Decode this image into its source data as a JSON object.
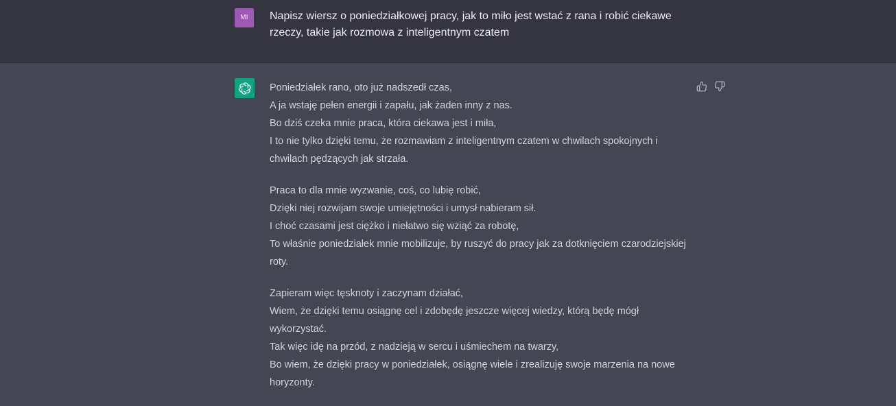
{
  "user_message": {
    "avatar_initials": "MI",
    "avatar_color": "#9d59b4",
    "text": "Napisz wiersz o poniedziałkowej pracy, jak to miło jest wstać z rana i robić ciekawe rzeczy, takie jak rozmowa z inteligentnym czatem"
  },
  "assistant_message": {
    "avatar_color": "#10a37f",
    "avatar_icon": "openai-logo-icon",
    "feedback": {
      "thumbs_up_icon": "thumbs-up-icon",
      "thumbs_down_icon": "thumbs-down-icon"
    },
    "stanzas": [
      {
        "lines": [
          "Poniedziałek rano, oto już nadszedł czas,",
          "A ja wstaję pełen energii i zapału, jak żaden inny z nas.",
          "Bo dziś czeka mnie praca, która ciekawa jest i miła,",
          "I to nie tylko dzięki temu, że rozmawiam z inteligentnym czatem w chwilach spokojnych i chwilach pędzących jak strzała."
        ]
      },
      {
        "lines": [
          "Praca to dla mnie wyzwanie, coś, co lubię robić,",
          "Dzięki niej rozwijam swoje umiejętności i umysł nabieram sił.",
          "I choć czasami jest ciężko i niełatwo się wziąć za robotę,",
          "To właśnie poniedziałek mnie mobilizuje, by ruszyć do pracy jak za dotknięciem czarodziejskiej roty."
        ]
      },
      {
        "lines": [
          "Zapieram więc tęsknoty i zaczynam działać,",
          "Wiem, że dzięki temu osiągnę cel i zdobędę jeszcze więcej wiedzy, którą będę mógł wykorzystać.",
          "Tak więc idę na przód, z nadzieją w sercu i uśmiechem na twarzy,",
          "Bo wiem, że dzięki pracy w poniedziałek, osiągnę wiele i zrealizuję swoje marzenia na nowe horyzonty."
        ]
      }
    ]
  }
}
